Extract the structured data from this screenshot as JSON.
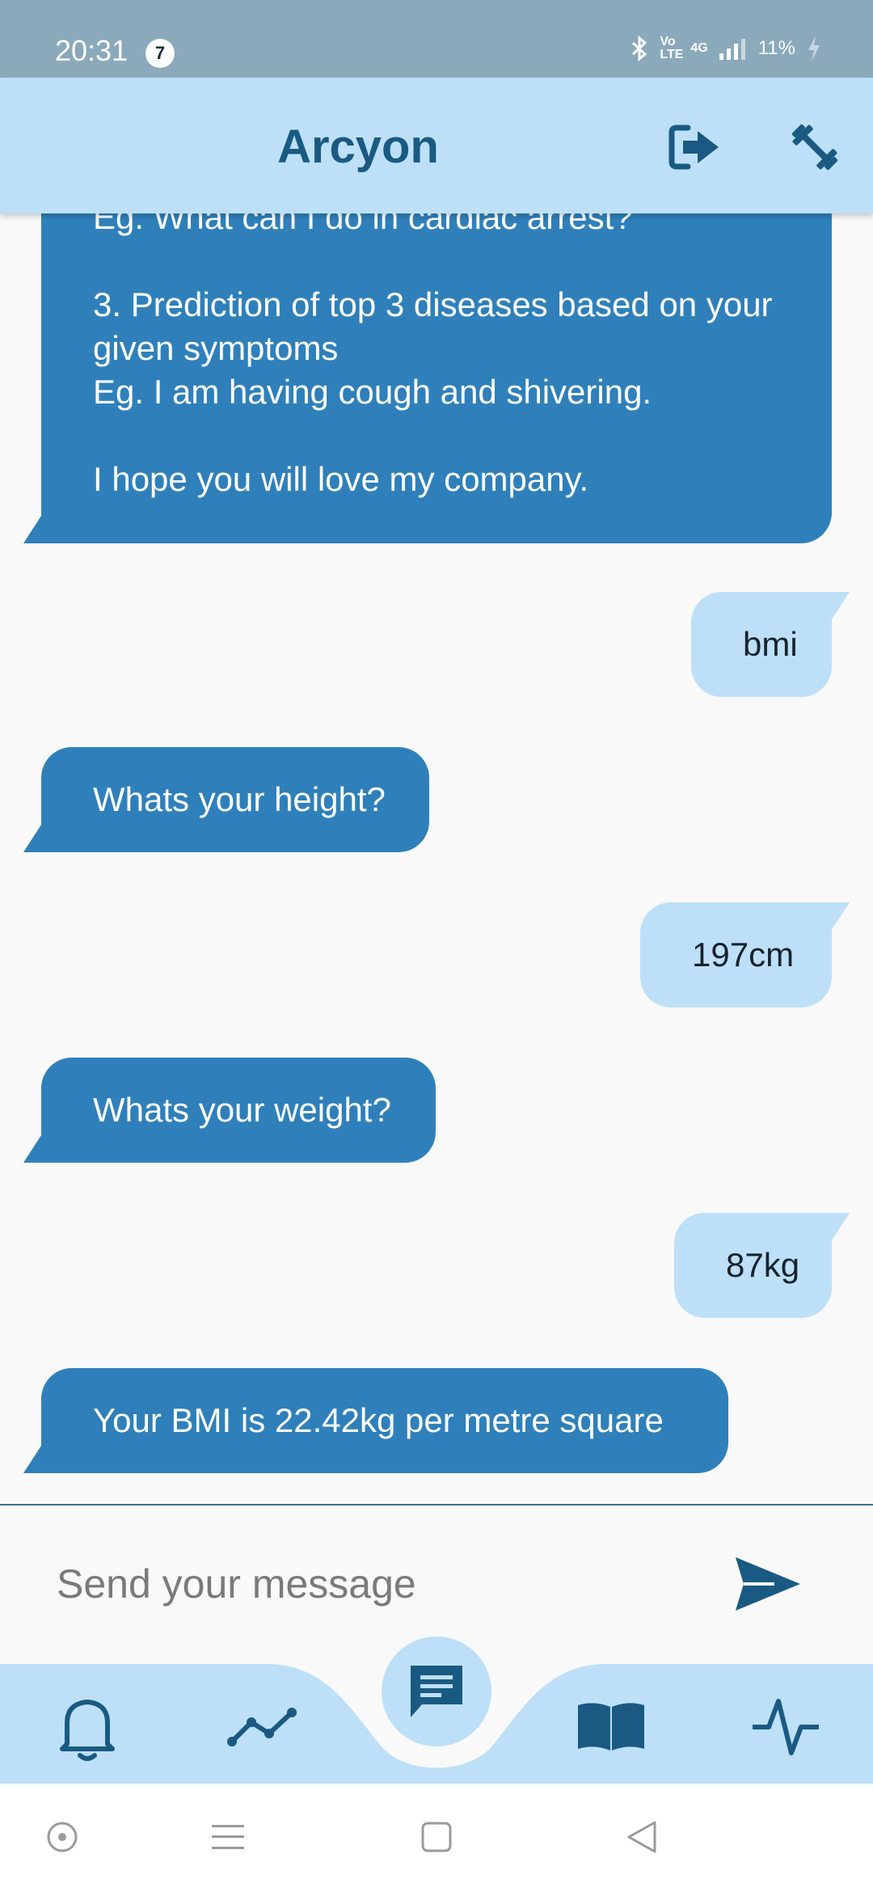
{
  "status_bar": {
    "time": "20:31",
    "notification_count": "7",
    "network_volte": "Vo LTE",
    "network_type": "4G",
    "battery": "11%"
  },
  "app_bar": {
    "title": "Arcyon",
    "logout_icon": "logout-icon",
    "fitness_icon": "dumbbell-icon"
  },
  "messages": [
    {
      "sender": "bot",
      "text": "  Eg. What can I do in cardiac arrest?\n\n3. Prediction of top 3 diseases based on your given symptoms\n  Eg. I am having cough and shivering.\n\nI hope you will love my company."
    },
    {
      "sender": "user",
      "text": "bmi"
    },
    {
      "sender": "bot",
      "text": "Whats your height?"
    },
    {
      "sender": "user",
      "text": "197cm"
    },
    {
      "sender": "bot",
      "text": "Whats your weight?"
    },
    {
      "sender": "user",
      "text": "87kg"
    },
    {
      "sender": "bot",
      "text": "Your BMI is 22.42kg per metre square"
    }
  ],
  "composer": {
    "placeholder": "Send your message",
    "send_icon": "send-icon"
  },
  "bottom_nav": {
    "items": [
      "bell-icon",
      "trend-chart-icon",
      "chat-icon",
      "book-icon",
      "pulse-icon"
    ],
    "active": "chat-icon"
  },
  "system_nav": [
    "assistant-icon",
    "menu-icon",
    "home-icon",
    "back-icon"
  ],
  "colors": {
    "status_bar": "#8aa9bb",
    "app_bar": "#bde0f8",
    "bot_bubble": "#2f80ba",
    "user_bubble": "#bde0f8",
    "accent_dark": "#1a5a82",
    "background": "#f9f9f9"
  }
}
